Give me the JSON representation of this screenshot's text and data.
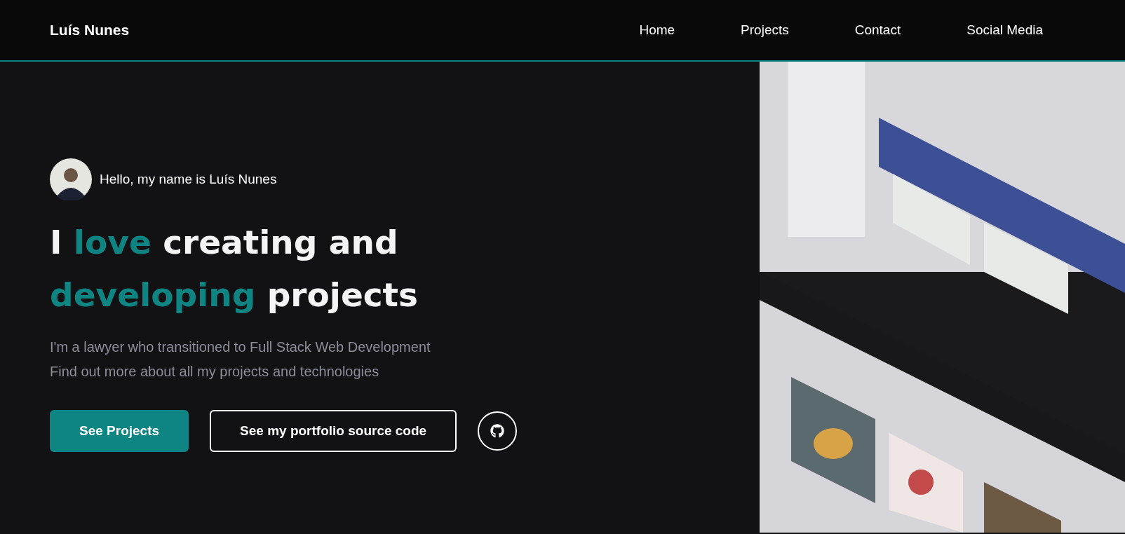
{
  "header": {
    "brand": "Luís Nunes",
    "nav": [
      {
        "label": "Home"
      },
      {
        "label": "Projects"
      },
      {
        "label": "Contact"
      },
      {
        "label": "Social Media"
      }
    ]
  },
  "hero": {
    "greeting": "Hello, my name is Luís Nunes",
    "headline": [
      {
        "text": "I ",
        "accent": false
      },
      {
        "text": "love",
        "accent": true
      },
      {
        "text": " creating and ",
        "accent": false
      },
      {
        "text": "developing",
        "accent": true
      },
      {
        "text": " projects",
        "accent": false
      }
    ],
    "description": [
      "I'm a lawyer who transitioned to Full Stack Web Development",
      "Find out more about all my projects and technologies"
    ],
    "buttons": [
      {
        "label": "See Projects",
        "kind": "primary"
      },
      {
        "label": "See my portfolio source code",
        "kind": "outline"
      }
    ]
  }
}
